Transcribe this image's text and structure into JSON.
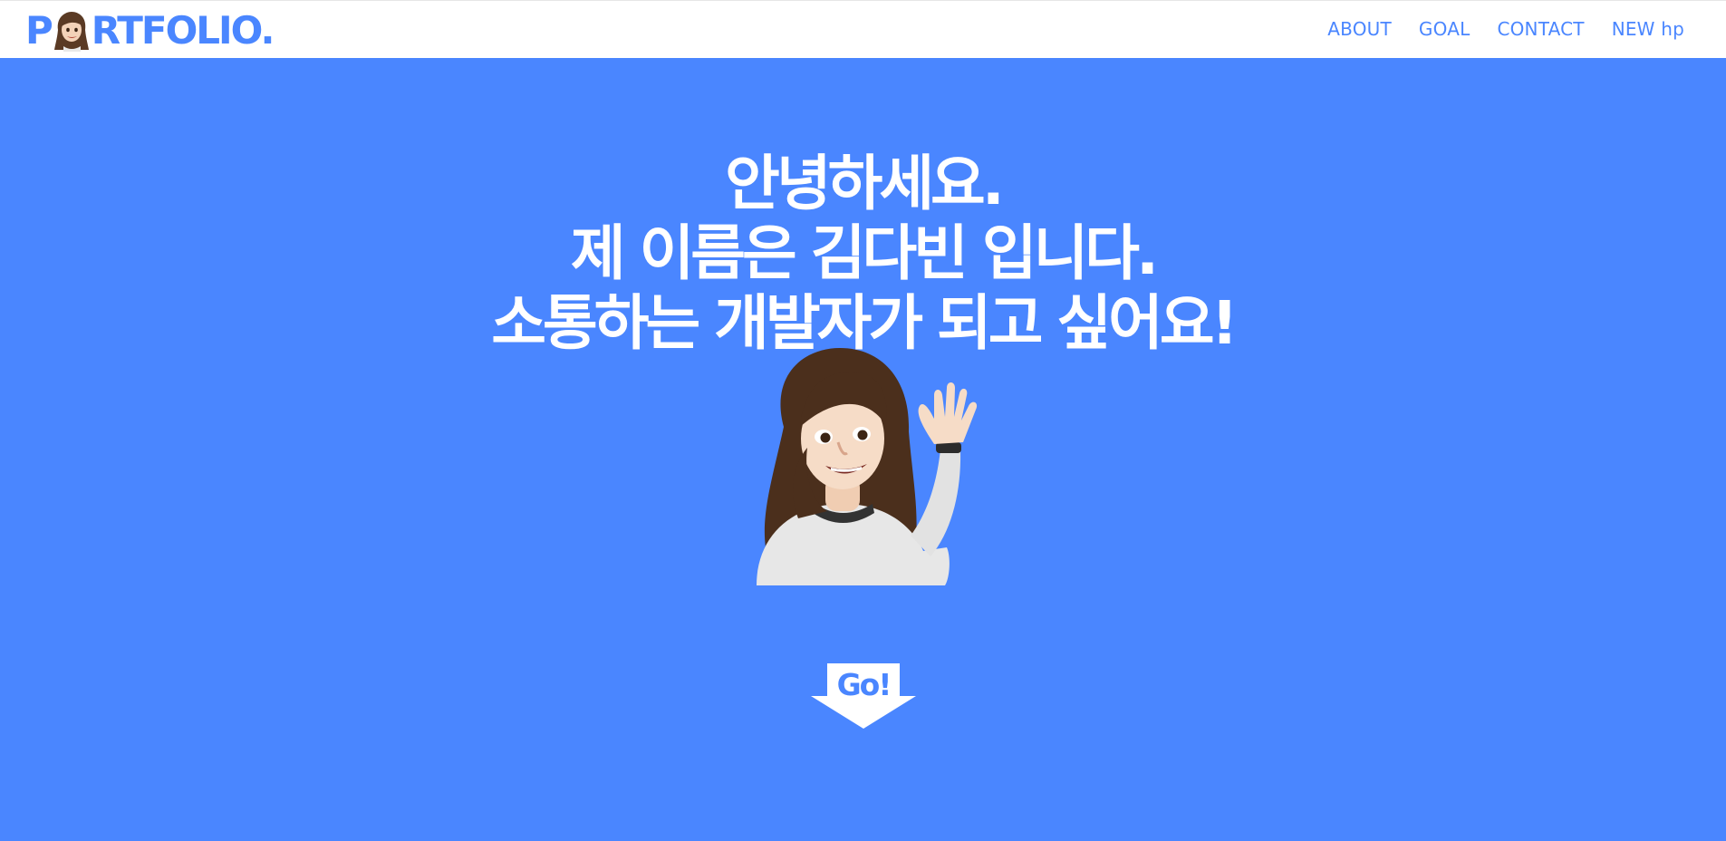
{
  "header": {
    "logo": {
      "before": "P",
      "after": "RTFOLIO."
    },
    "nav": [
      {
        "label": "ABOUT"
      },
      {
        "label": "GOAL"
      },
      {
        "label": "CONTACT"
      },
      {
        "label": "NEW hp"
      }
    ]
  },
  "hero": {
    "lines": [
      "안녕하세요.",
      "제 이름은 김다빈 입니다.",
      "소통하는 개발자가 되고 싶어요!"
    ],
    "go_label": "Go!"
  },
  "colors": {
    "brand_blue": "#4a86ff",
    "white": "#ffffff"
  },
  "icons": {
    "logo_o": "memoji-face-icon",
    "avatar": "memoji-waving-avatar",
    "go": "down-arrow-icon"
  }
}
